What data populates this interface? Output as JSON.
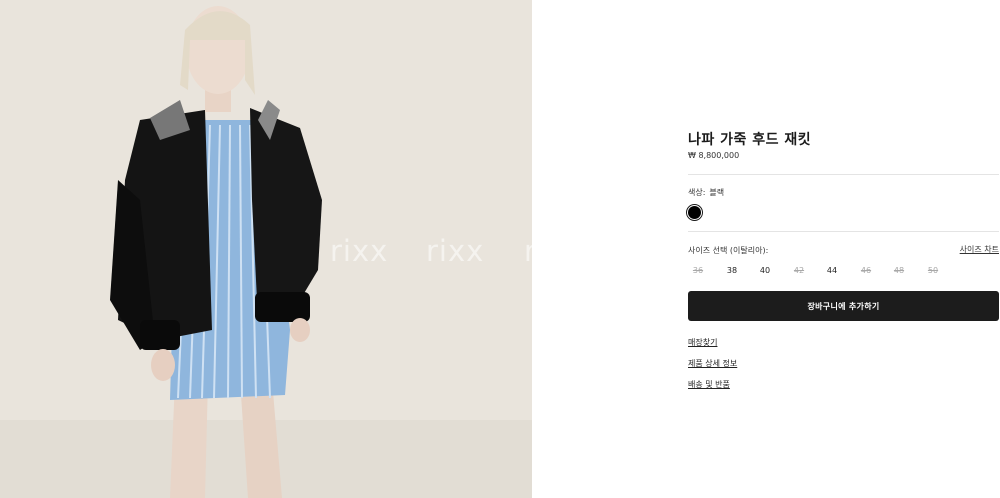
{
  "image": {
    "alt": "",
    "watermark": [
      "rixx",
      "rixx",
      "r"
    ]
  },
  "product": {
    "title": "나파 가죽 후드 재킷",
    "price": "₩ 8,800,000"
  },
  "color": {
    "label": "색상:",
    "value": "블랙",
    "swatches": [
      {
        "name": "블랙",
        "hex": "#000000",
        "selected": true
      }
    ]
  },
  "size": {
    "label": "사이즈 선택 (이탈리아):",
    "chart_link": "사이즈 차트",
    "options": [
      {
        "label": "36",
        "available": false
      },
      {
        "label": "38",
        "available": true
      },
      {
        "label": "40",
        "available": true
      },
      {
        "label": "42",
        "available": false
      },
      {
        "label": "44",
        "available": true
      },
      {
        "label": "46",
        "available": false
      },
      {
        "label": "48",
        "available": false
      },
      {
        "label": "50",
        "available": false
      }
    ]
  },
  "actions": {
    "add_to_cart": "장바구니에 추가하기"
  },
  "links": {
    "store_finder": "매장찾기",
    "product_details": "제품 상세 정보",
    "shipping_returns": "배송 및 반품"
  }
}
